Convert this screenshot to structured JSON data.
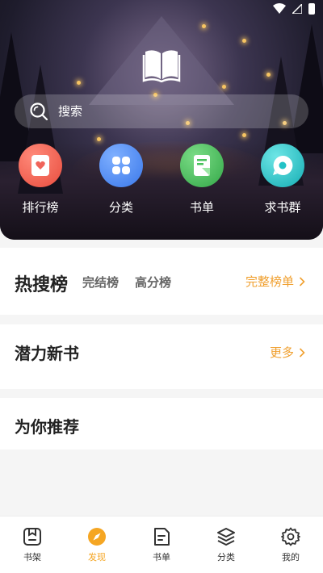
{
  "search": {
    "placeholder": "搜索"
  },
  "quick_links": [
    {
      "label": "排行榜",
      "icon": "ranking-icon",
      "color": "#f0645a"
    },
    {
      "label": "分类",
      "icon": "category-icon",
      "color": "#4a8cf5"
    },
    {
      "label": "书单",
      "icon": "booklist-icon",
      "color": "#47c15a"
    },
    {
      "label": "求书群",
      "icon": "chat-group-icon",
      "color": "#22c2c6"
    }
  ],
  "hot_search": {
    "title": "热搜榜",
    "tabs": [
      "完结榜",
      "高分榜"
    ],
    "more": "完整榜单"
  },
  "new_books": {
    "title": "潜力新书",
    "more": "更多"
  },
  "recommend": {
    "title": "为你推荐"
  },
  "bottom_nav": [
    {
      "label": "书架",
      "icon": "bookshelf-icon",
      "active": false
    },
    {
      "label": "发现",
      "icon": "compass-icon",
      "active": true
    },
    {
      "label": "书单",
      "icon": "document-icon",
      "active": false
    },
    {
      "label": "分类",
      "icon": "layers-icon",
      "active": false
    },
    {
      "label": "我的",
      "icon": "gear-icon",
      "active": false
    }
  ],
  "accent_color": "#f5a623"
}
